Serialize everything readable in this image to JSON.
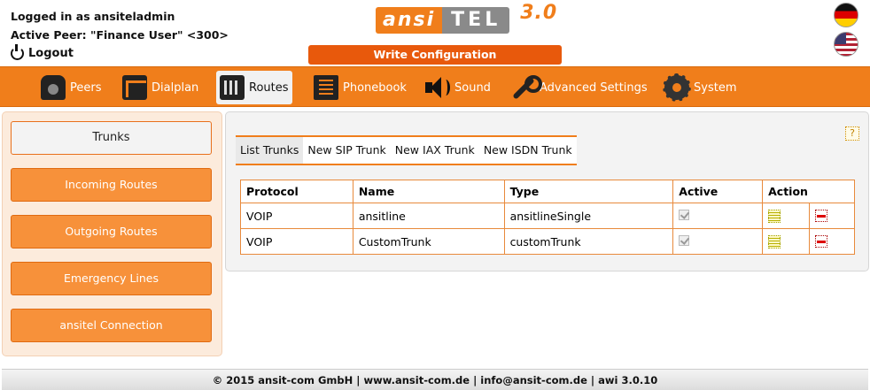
{
  "header": {
    "logged_in": "Logged in as ansiteladmin",
    "active_peer": "Active Peer: \"Finance User\" <300>",
    "logout_label": "Logout",
    "logo_ansi": "ansi",
    "logo_tel": "TEL",
    "logo_version": "3.0",
    "write_config_label": "Write Configuration",
    "flags": [
      "flag-germany-icon",
      "flag-usa-icon"
    ]
  },
  "nav": {
    "items": [
      {
        "label": "Peers",
        "icon": "phone-icon"
      },
      {
        "label": "Dialplan",
        "icon": "dialplan-icon"
      },
      {
        "label": "Routes",
        "icon": "routes-icon",
        "active": true
      },
      {
        "label": "Phonebook",
        "icon": "phonebook-icon"
      },
      {
        "label": "Sound",
        "icon": "speaker-icon"
      },
      {
        "label": "Advanced Settings",
        "icon": "wrench-icon"
      },
      {
        "label": "System",
        "icon": "gear-icon"
      }
    ]
  },
  "sidebar": {
    "items": [
      {
        "label": "Trunks",
        "active": true
      },
      {
        "label": "Incoming Routes"
      },
      {
        "label": "Outgoing Routes"
      },
      {
        "label": "Emergency Lines"
      },
      {
        "label": "ansitel Connection"
      }
    ]
  },
  "content": {
    "help_label": "?",
    "tabs": [
      "List Trunks",
      "New SIP Trunk",
      "New IAX Trunk",
      "New ISDN Trunk"
    ],
    "active_tab": "List Trunks",
    "table": {
      "headers": [
        "Protocol",
        "Name",
        "Type",
        "Active",
        "Action"
      ],
      "rows": [
        {
          "protocol": "VOIP",
          "name": "ansitline",
          "type": "ansitlineSingle",
          "active": true
        },
        {
          "protocol": "VOIP",
          "name": "CustomTrunk",
          "type": "customTrunk",
          "active": true
        }
      ]
    }
  },
  "footer": {
    "text": "© 2015 ansit-com GmbH | www.ansit-com.de | info@ansit-com.de | awi 3.0.10"
  },
  "colors": {
    "accent": "#f07e1b",
    "write_button": "#e8590c",
    "sidebar_bg": "#fcebdc"
  }
}
